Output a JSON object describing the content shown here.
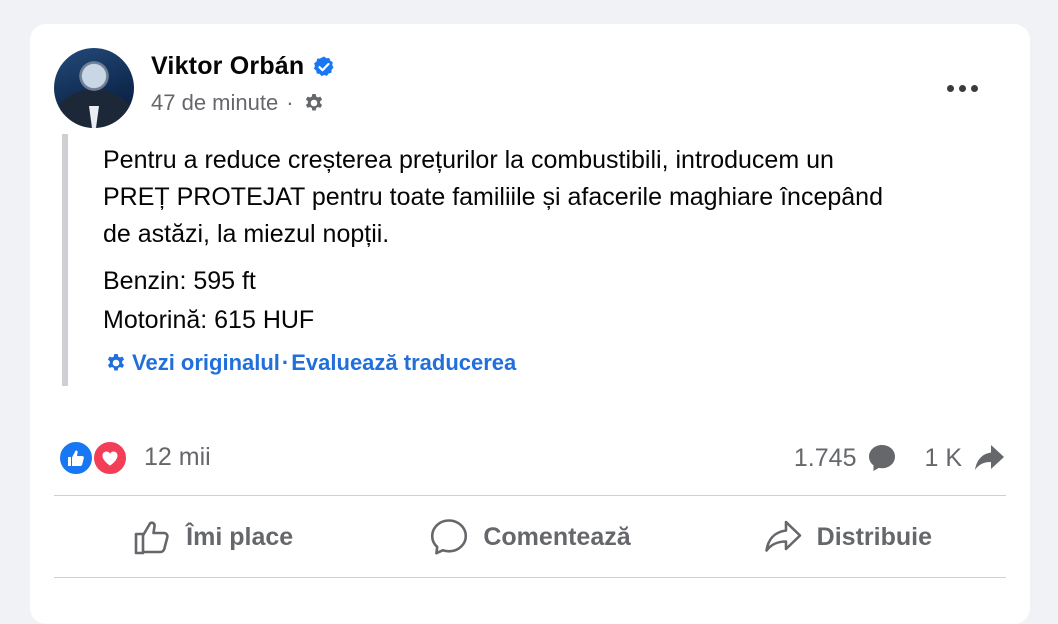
{
  "post": {
    "author": "Viktor Orbán",
    "time": "47 de minute",
    "separator": "·",
    "text": {
      "line1": "Pentru a reduce creșterea prețurilor la combustibili, introducem un",
      "line2": "PREȚ PROTEJAT pentru toate familiile și afacerile maghiare începând",
      "line3": "de astăzi, la miezul nopții.",
      "line4": "Benzin: 595 ft",
      "line5": "Motorină: 615 HUF"
    },
    "translation": {
      "see_original": "Vezi originalul",
      "separator": "·",
      "rate": "Evaluează traducerea"
    }
  },
  "stats": {
    "reactions": "12 mii",
    "comments": "1.745",
    "shares": "1 K"
  },
  "actions": {
    "like": "Îmi place",
    "comment": "Comentează",
    "share": "Distribuie"
  },
  "icons": {
    "verified": "verified-badge-icon",
    "audience": "gear-icon",
    "more": "more-icon"
  },
  "colors": {
    "accent": "#216fdb",
    "like": "#1877f2",
    "love": "#f33e58",
    "secondary_text": "#65676b"
  }
}
